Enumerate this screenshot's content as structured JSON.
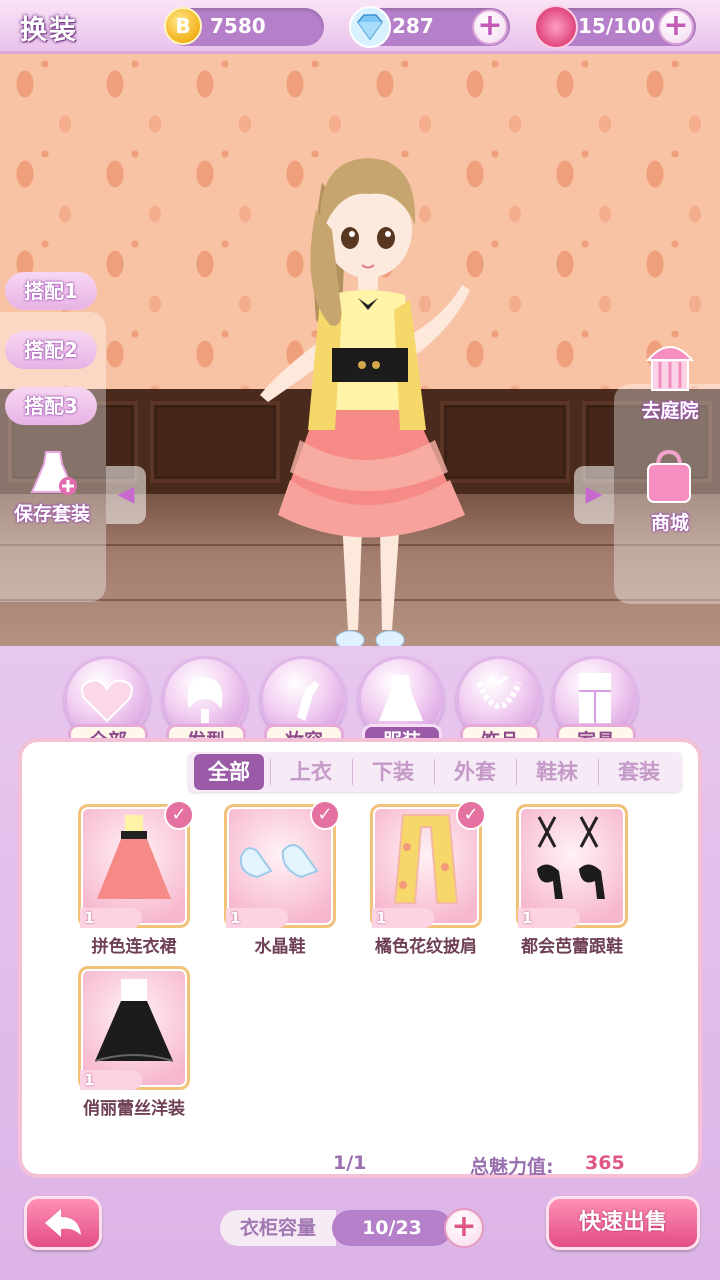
{
  "header": {
    "title": "换装",
    "coins": "7580",
    "diamonds": "287",
    "roses": "15/100"
  },
  "outfit_slots": [
    "搭配1",
    "搭配2",
    "搭配3"
  ],
  "save_outfit_label": "保存套装",
  "right_buttons": {
    "garden": "去庭院",
    "shop": "商城"
  },
  "categories": [
    {
      "label": "全部",
      "icon": "heart-icon"
    },
    {
      "label": "发型",
      "icon": "hair-icon"
    },
    {
      "label": "妆容",
      "icon": "lipstick-icon"
    },
    {
      "label": "服装",
      "icon": "dress-icon",
      "active": true
    },
    {
      "label": "饰品",
      "icon": "necklace-icon"
    },
    {
      "label": "家具",
      "icon": "cabinet-icon"
    }
  ],
  "subtabs": [
    "全部",
    "上衣",
    "下装",
    "外套",
    "鞋袜",
    "套装"
  ],
  "items": [
    {
      "name": "拼色连衣裙",
      "count": "1",
      "equipped": true,
      "icon": "pink-dress-icon"
    },
    {
      "name": "水晶鞋",
      "count": "1",
      "equipped": true,
      "icon": "crystal-shoes-icon"
    },
    {
      "name": "橘色花纹披肩",
      "count": "1",
      "equipped": true,
      "icon": "floral-shawl-icon"
    },
    {
      "name": "都会芭蕾跟鞋",
      "count": "1",
      "equipped": false,
      "icon": "ballet-heels-icon"
    },
    {
      "name": "俏丽蕾丝洋装",
      "count": "1",
      "equipped": false,
      "icon": "black-lace-dress-icon"
    }
  ],
  "pagination": "1/1",
  "charm_label": "总魅力值:",
  "charm_value": "365",
  "capacity_label": "衣柜容量",
  "capacity_value": "10/23",
  "sell_label": "快速出售",
  "colors": {
    "accent_purple": "#9a5aa8",
    "accent_pink": "#e24e86",
    "wall": "#f8c3a4"
  }
}
